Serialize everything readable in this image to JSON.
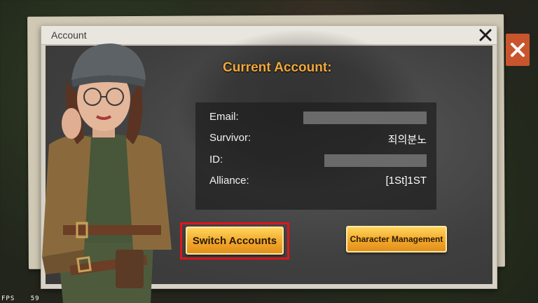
{
  "dialog": {
    "title": "Account",
    "heading": "Current Account:"
  },
  "account": {
    "email_label": "Email:",
    "email_value": "",
    "survivor_label": "Survivor:",
    "survivor_value": "죄의분노",
    "id_label": "ID:",
    "id_value": "",
    "alliance_label": "Alliance:",
    "alliance_value": "[1St]1ST"
  },
  "buttons": {
    "switch_accounts": "Switch Accounts",
    "character_management": "Character Management"
  },
  "hud": {
    "fps_label": "FPS",
    "fps_value": "59"
  },
  "icons": {
    "close": "close-icon",
    "back_close": "close-icon"
  },
  "colors": {
    "heading": "#f2a93b",
    "button_orange": "#f3a82a",
    "highlight": "#e0151b",
    "back_close": "#c9552d"
  }
}
